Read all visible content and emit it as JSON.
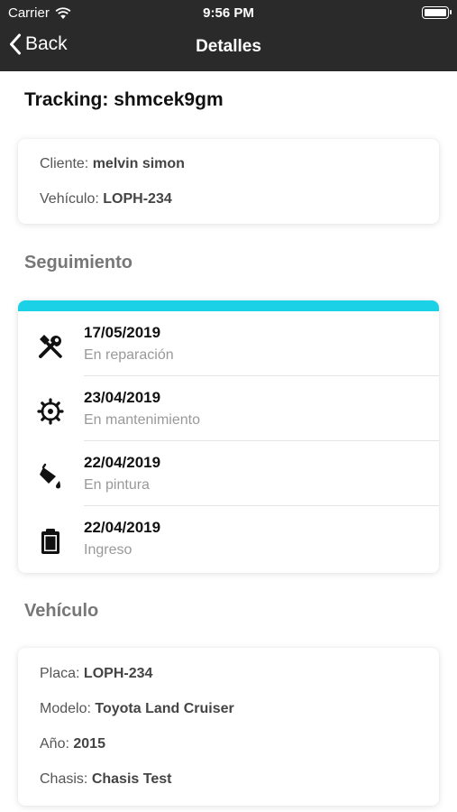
{
  "status_bar": {
    "carrier": "Carrier",
    "time": "9:56 PM"
  },
  "nav": {
    "back_label": "Back",
    "title": "Detalles"
  },
  "tracking": {
    "label": "Tracking:",
    "code": "shmcek9gm"
  },
  "client_card": {
    "client_label": "Cliente:",
    "client_value": "melvin simon",
    "vehicle_label": "Vehículo:",
    "vehicle_value": "LOPH-234"
  },
  "seguimiento": {
    "title": "Seguimiento",
    "accent_color": "#1bd1e6",
    "items": [
      {
        "date": "17/05/2019",
        "status": "En reparación",
        "icon": "tools-icon"
      },
      {
        "date": "23/04/2019",
        "status": "En mantenimiento",
        "icon": "gear-icon"
      },
      {
        "date": "22/04/2019",
        "status": "En pintura",
        "icon": "paint-bucket-icon"
      },
      {
        "date": "22/04/2019",
        "status": "Ingreso",
        "icon": "clipboard-icon"
      }
    ]
  },
  "vehiculo": {
    "title": "Vehículo",
    "placa_label": "Placa:",
    "placa_value": "LOPH-234",
    "modelo_label": "Modelo:",
    "modelo_value": "Toyota Land Cruiser",
    "anio_label": "Año:",
    "anio_value": "2015",
    "chasis_label": "Chasis:",
    "chasis_value": "Chasis Test"
  }
}
